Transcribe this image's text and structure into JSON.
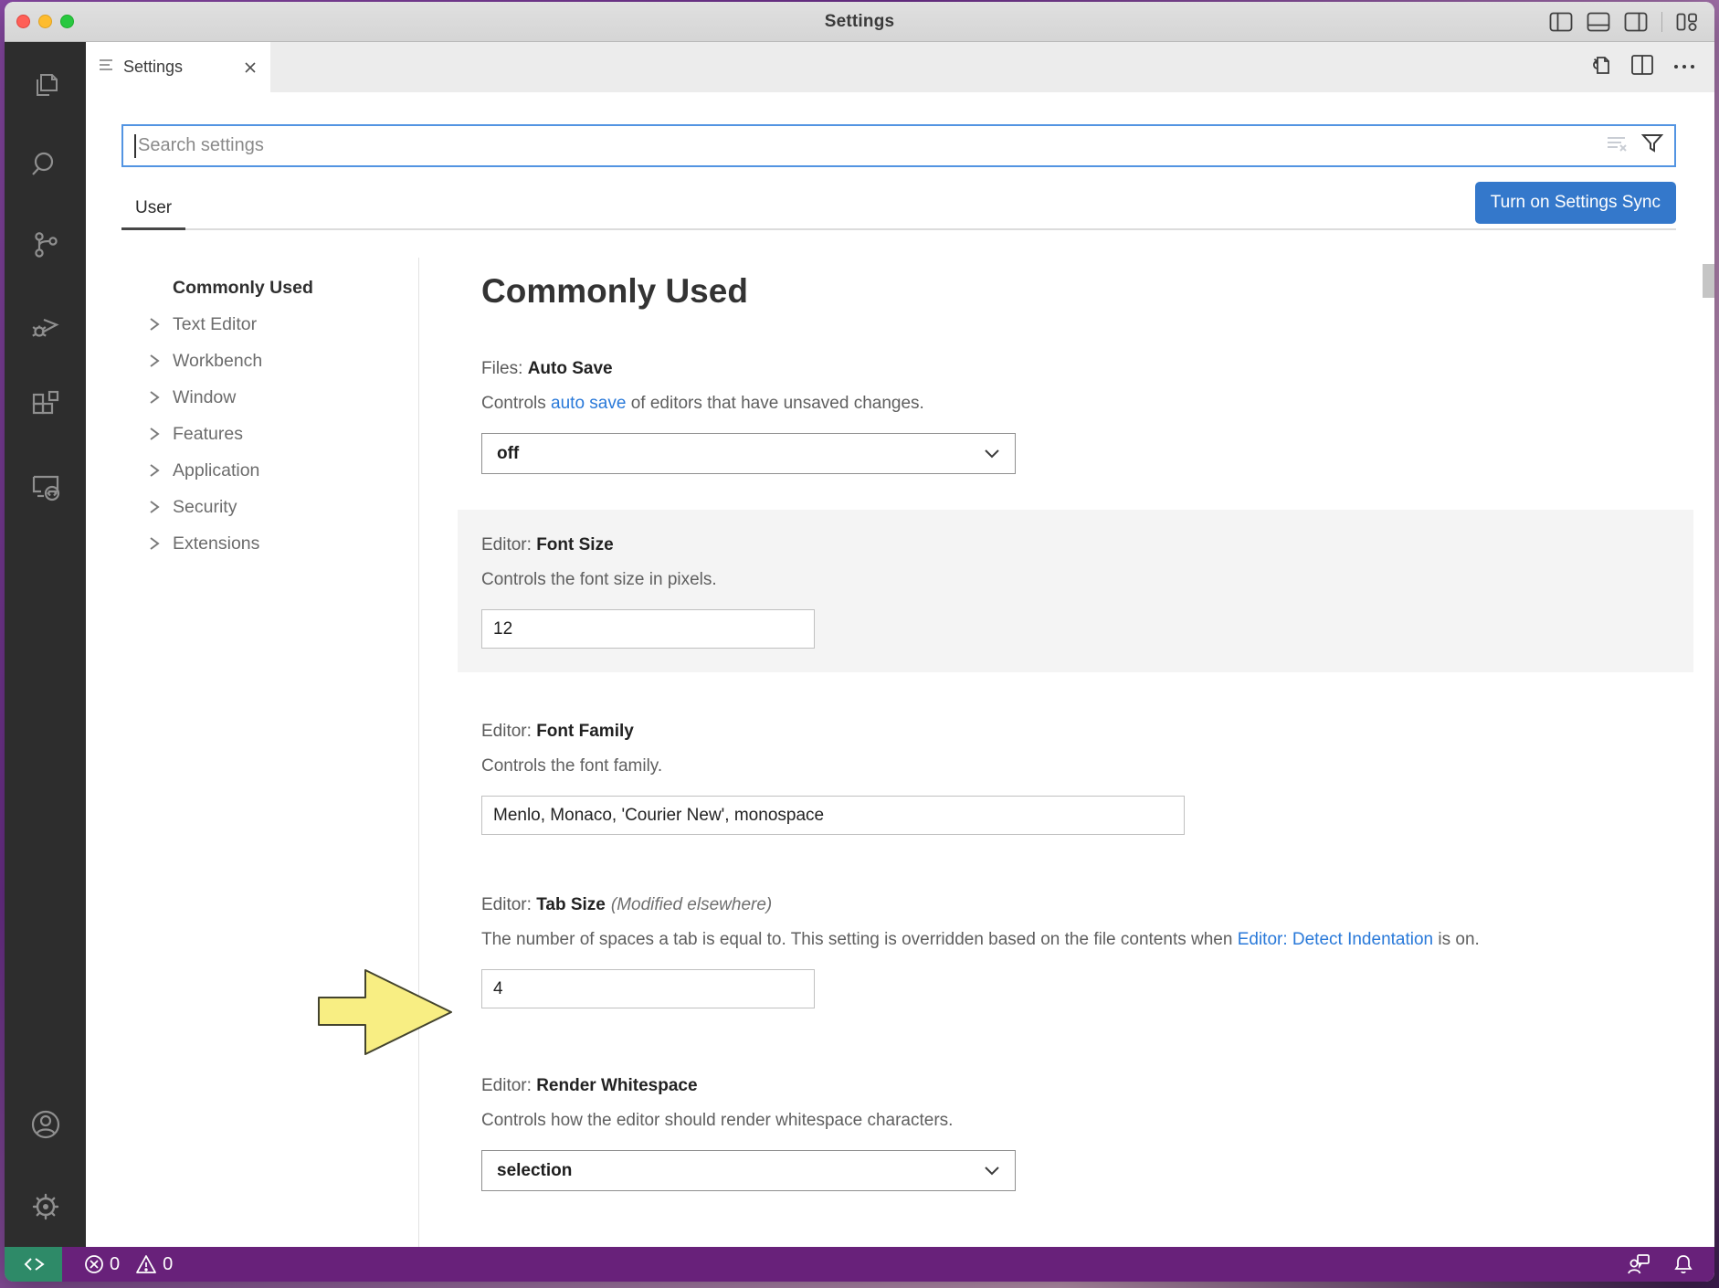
{
  "window": {
    "title": "Settings"
  },
  "tab": {
    "label": "Settings"
  },
  "search": {
    "placeholder": "Search settings"
  },
  "scope": {
    "user_tab": "User",
    "sync_button": "Turn on Settings Sync"
  },
  "toc": {
    "items": [
      {
        "label": "Commonly Used"
      },
      {
        "label": "Text Editor"
      },
      {
        "label": "Workbench"
      },
      {
        "label": "Window"
      },
      {
        "label": "Features"
      },
      {
        "label": "Application"
      },
      {
        "label": "Security"
      },
      {
        "label": "Extensions"
      }
    ]
  },
  "content": {
    "heading": "Commonly Used",
    "settings": [
      {
        "category": "Files: ",
        "name": "Auto Save",
        "desc_pre": "Controls ",
        "desc_link": "auto save",
        "desc_post": " of editors that have unsaved changes.",
        "control_type": "select",
        "value": "off"
      },
      {
        "category": "Editor: ",
        "name": "Font Size",
        "desc_pre": "Controls the font size in pixels.",
        "control_type": "input",
        "value": "12"
      },
      {
        "category": "Editor: ",
        "name": "Font Family",
        "desc_pre": "Controls the font family.",
        "control_type": "input",
        "value": "Menlo, Monaco, 'Courier New', monospace"
      },
      {
        "category": "Editor: ",
        "name": "Tab Size",
        "badge": "(Modified elsewhere)",
        "desc_pre": "The number of spaces a tab is equal to. This setting is overridden based on the file contents when ",
        "desc_link": "Editor: Detect Indentation",
        "desc_post": " is on.",
        "control_type": "input",
        "value": "4"
      },
      {
        "category": "Editor: ",
        "name": "Render Whitespace",
        "desc_pre": "Controls how the editor should render whitespace characters.",
        "control_type": "select",
        "value": "selection"
      }
    ]
  },
  "status_bar": {
    "error_count": "0",
    "warning_count": "0"
  },
  "colors": {
    "accent_button_blue": "#3478cb",
    "focus_border_blue": "#5294e2",
    "link_blue": "#2979d9",
    "status_bar_purple": "#68217a",
    "remote_indicator_green": "#2e8a68",
    "annotation_arrow_yellow": "#f8ee83",
    "activity_bar_dark": "#2d2d2d"
  }
}
